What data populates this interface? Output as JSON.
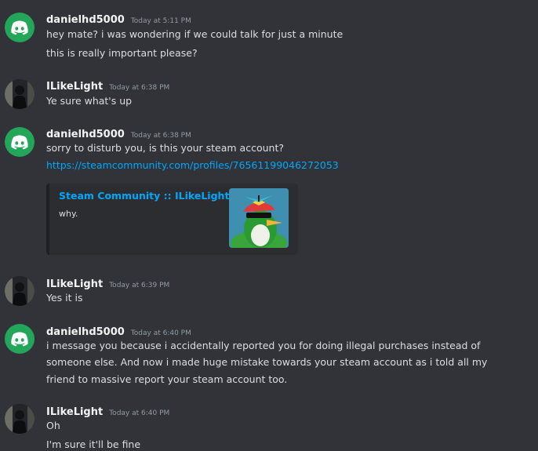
{
  "messages": [
    {
      "username": "danielhd5000",
      "timestamp": "Today at 5:11 PM",
      "lines": [
        "hey mate? i was wondering if we could talk for just a minute",
        "this is really important please?"
      ]
    },
    {
      "username": "ILikeLight",
      "timestamp": "Today at 6:38 PM",
      "lines": [
        "Ye sure what's up"
      ]
    },
    {
      "username": "danielhd5000",
      "timestamp": "Today at 6:38 PM",
      "lines": [
        "sorry to disturb you, is this your steam account?"
      ],
      "link": "https://steamcommunity.com/profiles/76561199046272053",
      "embed": {
        "title": "Steam Community :: ILikeLight",
        "description": "why."
      }
    },
    {
      "username": "ILikeLight",
      "timestamp": "Today at 6:39 PM",
      "lines": [
        "Yes it is"
      ]
    },
    {
      "username": "danielhd5000",
      "timestamp": "Today at 6:40 PM",
      "lines": [
        "i message you because i accidentally reported you for doing illegal purchases instead of",
        "someone else. And now i made huge mistake towards your steam account as i told all my",
        "friend to massive report  your steam account too."
      ]
    },
    {
      "username": "ILikeLight",
      "timestamp": "Today at 6:40 PM",
      "lines": [
        "Oh",
        "I'm sure it'll be fine"
      ]
    }
  ],
  "icons": {
    "discord_avatar": "discord-logo-icon",
    "user_avatar": "user-photo-avatar",
    "embed_thumbnail": "penguin-propeller-hat-image"
  },
  "colors": {
    "background": "#313338",
    "username": "#f2f3f5",
    "text": "#dbdee1",
    "timestamp": "#949ba4",
    "link": "#00a8fc",
    "discord_green": "#23a55a"
  }
}
